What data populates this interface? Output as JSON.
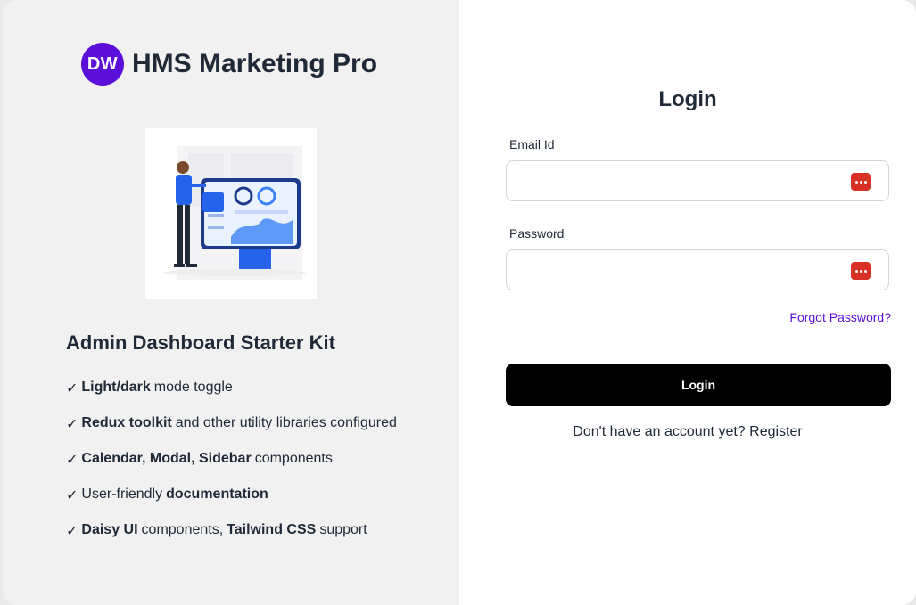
{
  "brand": {
    "logo_text": "DW",
    "name": "HMS Marketing Pro",
    "logo_color": "#5b0fd9"
  },
  "kit": {
    "title": "Admin Dashboard Starter Kit",
    "features": [
      {
        "check": "✓",
        "parts": [
          [
            "b",
            "Light/dark"
          ],
          [
            "t",
            "mode toggle"
          ]
        ]
      },
      {
        "check": "✓",
        "parts": [
          [
            "b",
            "Redux toolkit"
          ],
          [
            "t",
            "and other utility libraries configured"
          ]
        ]
      },
      {
        "check": "✓",
        "parts": [
          [
            "b",
            "Calendar, Modal, Sidebar"
          ],
          [
            "t",
            "components"
          ]
        ]
      },
      {
        "check": "✓",
        "parts": [
          [
            "t",
            "User-friendly"
          ],
          [
            "b",
            "documentation"
          ]
        ]
      },
      {
        "check": "✓",
        "parts": [
          [
            "b",
            "Daisy UI"
          ],
          [
            "t",
            "components,"
          ],
          [
            "b",
            "Tailwind CSS"
          ],
          [
            "t",
            "support"
          ]
        ]
      }
    ]
  },
  "login": {
    "title": "Login",
    "email_label": "Email Id",
    "email_value": "",
    "password_label": "Password",
    "password_value": "",
    "forgot_label": "Forgot Password?",
    "button_label": "Login",
    "register_prompt": "Don't have an account yet?",
    "register_link": "Register",
    "password_manager_icon": "password-manager-icon",
    "password_manager_color": "#d93025"
  }
}
